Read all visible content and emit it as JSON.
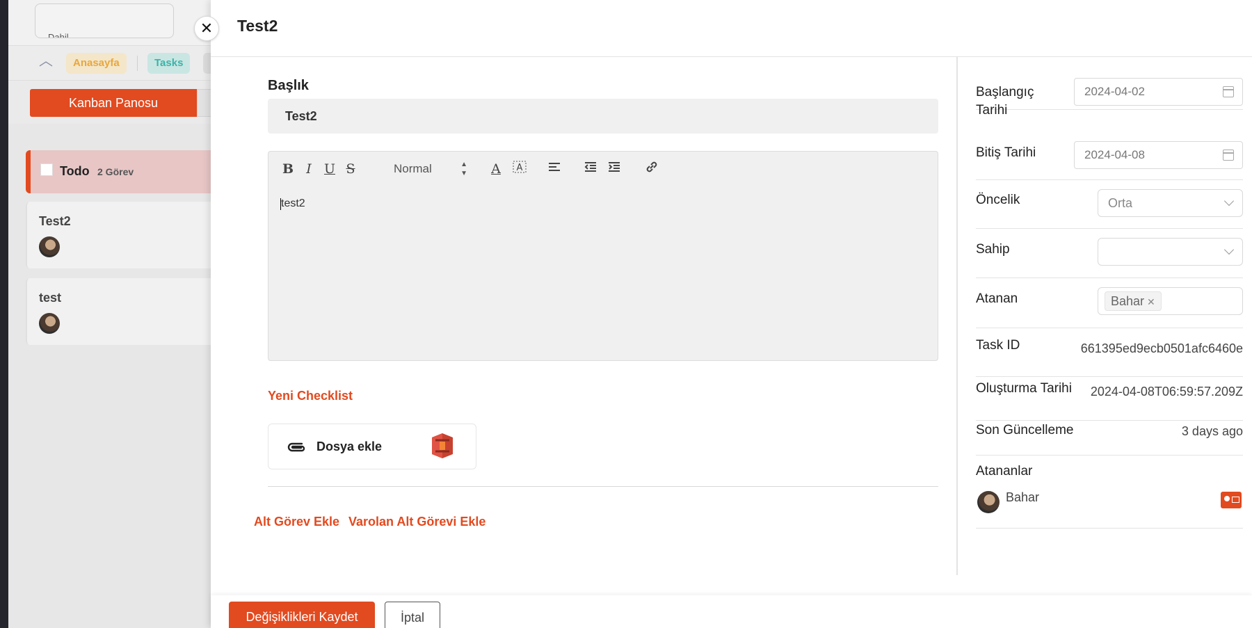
{
  "background": {
    "search_text": "Dahil",
    "tabs": [
      {
        "label": "Anasayfa"
      },
      {
        "label": "Tasks"
      }
    ],
    "view_button": "Kanban Panosu",
    "column": {
      "title": "Todo",
      "count": "2 Görev"
    },
    "cards": [
      {
        "title": "Test2"
      },
      {
        "title": "test"
      }
    ]
  },
  "drawer": {
    "title": "Test2",
    "title_field_label": "Başlık",
    "title_value": "Test2",
    "editor": {
      "heading_select": "Normal",
      "content": "test2"
    },
    "new_checklist": "Yeni Checklist",
    "attach_label": "Dosya ekle",
    "add_subtask": "Alt Görev Ekle",
    "add_existing_subtask": "Varolan Alt Görevi Ekle"
  },
  "side": {
    "start_date_label": "Başlangıç Tarihi",
    "start_date": "2024-04-02",
    "end_date_label": "Bitiş Tarihi",
    "end_date": "2024-04-08",
    "priority_label": "Öncelik",
    "priority": "Orta",
    "owner_label": "Sahip",
    "owner": "",
    "assigned_label": "Atanan",
    "assigned_tag": "Bahar",
    "task_id_label": "Task ID",
    "task_id": "661395ed9ecb0501afc6460e",
    "created_label": "Oluşturma Tarihi",
    "created": "2024-04-08T06:59:57.209Z",
    "updated_label": "Son Güncelleme",
    "updated": "3 days ago",
    "assignees_label": "Atananlar",
    "assignees": [
      {
        "name": "Bahar"
      }
    ]
  },
  "footer": {
    "save": "Değişiklikleri Kaydet",
    "cancel": "İptal"
  },
  "colors": {
    "accent": "#e24a1f"
  }
}
